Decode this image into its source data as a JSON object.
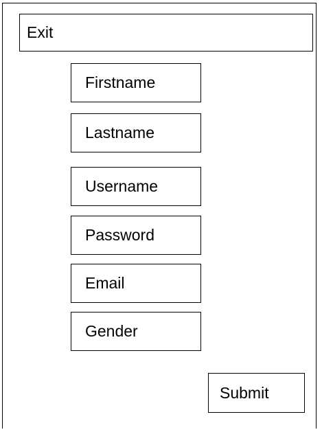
{
  "header": {
    "exit_label": "Exit"
  },
  "form": {
    "fields": [
      {
        "label": "Firstname"
      },
      {
        "label": "Lastname"
      },
      {
        "label": "Username"
      },
      {
        "label": "Password"
      },
      {
        "label": "Email"
      },
      {
        "label": "Gender"
      }
    ],
    "submit_label": "Submit"
  }
}
